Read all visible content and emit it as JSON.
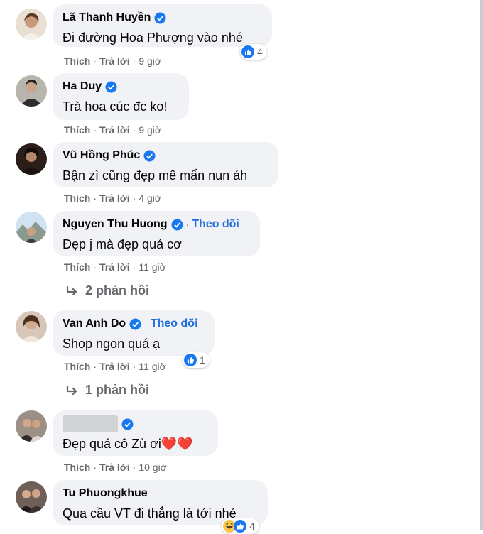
{
  "labels": {
    "like": "Thích",
    "reply": "Trả lời",
    "dot": "·",
    "follow": "Theo dõi"
  },
  "comments": [
    {
      "name": "Lã Thanh Huyền",
      "text": "Đi đường Hoa Phượng vào nhé",
      "time": "9 giờ",
      "reactions": "4",
      "reaction_icons": [
        "like-icon"
      ]
    },
    {
      "name": "Ha Duy",
      "text": "Trà hoa cúc đc ko!",
      "time": "9 giờ"
    },
    {
      "name": "Vũ Hồng Phúc",
      "text": "Bận zì cũng đẹp mê mẩn nun áh",
      "time": "4 giờ"
    },
    {
      "name": "Nguyen Thu Huong",
      "text": "Đẹp j mà đẹp quá cơ",
      "time": "11 giờ",
      "follow": true,
      "replies": "2 phản hồi"
    },
    {
      "name": "Van Anh Do",
      "text": "Shop ngon quá ạ",
      "time": "11 giờ",
      "follow": true,
      "reactions": "1",
      "reaction_icons": [
        "like-icon"
      ],
      "replies": "1 phản hồi"
    },
    {
      "name": "",
      "name_hidden": true,
      "text": "Đẹp quá cô Zù ơi❤️❤️",
      "time": "10 giờ"
    },
    {
      "name": "Tu Phuongkhue",
      "text": "Qua cầu VT đi thẳng là tới nhé",
      "reactions": "4",
      "reaction_icons": [
        "haha-icon",
        "like-icon"
      ]
    }
  ],
  "colors": {
    "bubble": "#f0f2f5",
    "secondary_text": "#65676b",
    "verified": "#1877f2",
    "follow": "#216fdb"
  }
}
